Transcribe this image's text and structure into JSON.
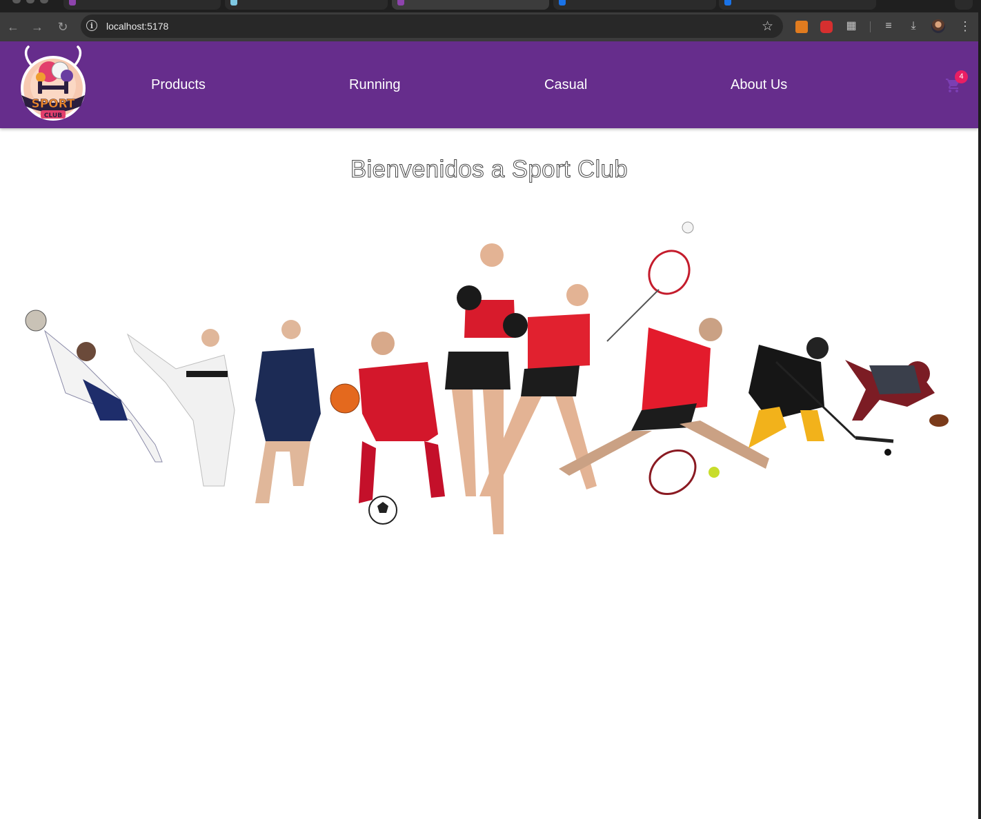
{
  "browser": {
    "url": "localhost:5178",
    "tabs": [
      {
        "favicon_color": "#8e44ad",
        "active": false
      },
      {
        "favicon_color": "#7ec8e3",
        "active": false
      },
      {
        "favicon_color": "#8e44ad",
        "active": true
      },
      {
        "favicon_color": "#1a73e8",
        "active": false
      },
      {
        "favicon_color": "#1a73e8",
        "active": false
      }
    ],
    "extension_icons": [
      "back-icon",
      "forward-icon",
      "reload-icon",
      "site-info-icon",
      "bookmark-star-icon",
      "extension-orange-icon",
      "extension-red-icon",
      "extensions-puzzle-icon",
      "media-control-icon",
      "download-icon",
      "profile-avatar",
      "menu-kebab-icon"
    ]
  },
  "header": {
    "background": "#662d8c",
    "logo": {
      "line1": "SPORT",
      "line2": "CLUB"
    },
    "nav": [
      {
        "label": "Products"
      },
      {
        "label": "Running"
      },
      {
        "label": "Casual"
      },
      {
        "label": "About Us"
      }
    ],
    "cart": {
      "count": "4",
      "badge_color": "#e91e63",
      "icon": "shopping-cart-icon"
    }
  },
  "main": {
    "title": "Bienvenidos a Sport Club",
    "hero_image": "athletes-collage"
  }
}
